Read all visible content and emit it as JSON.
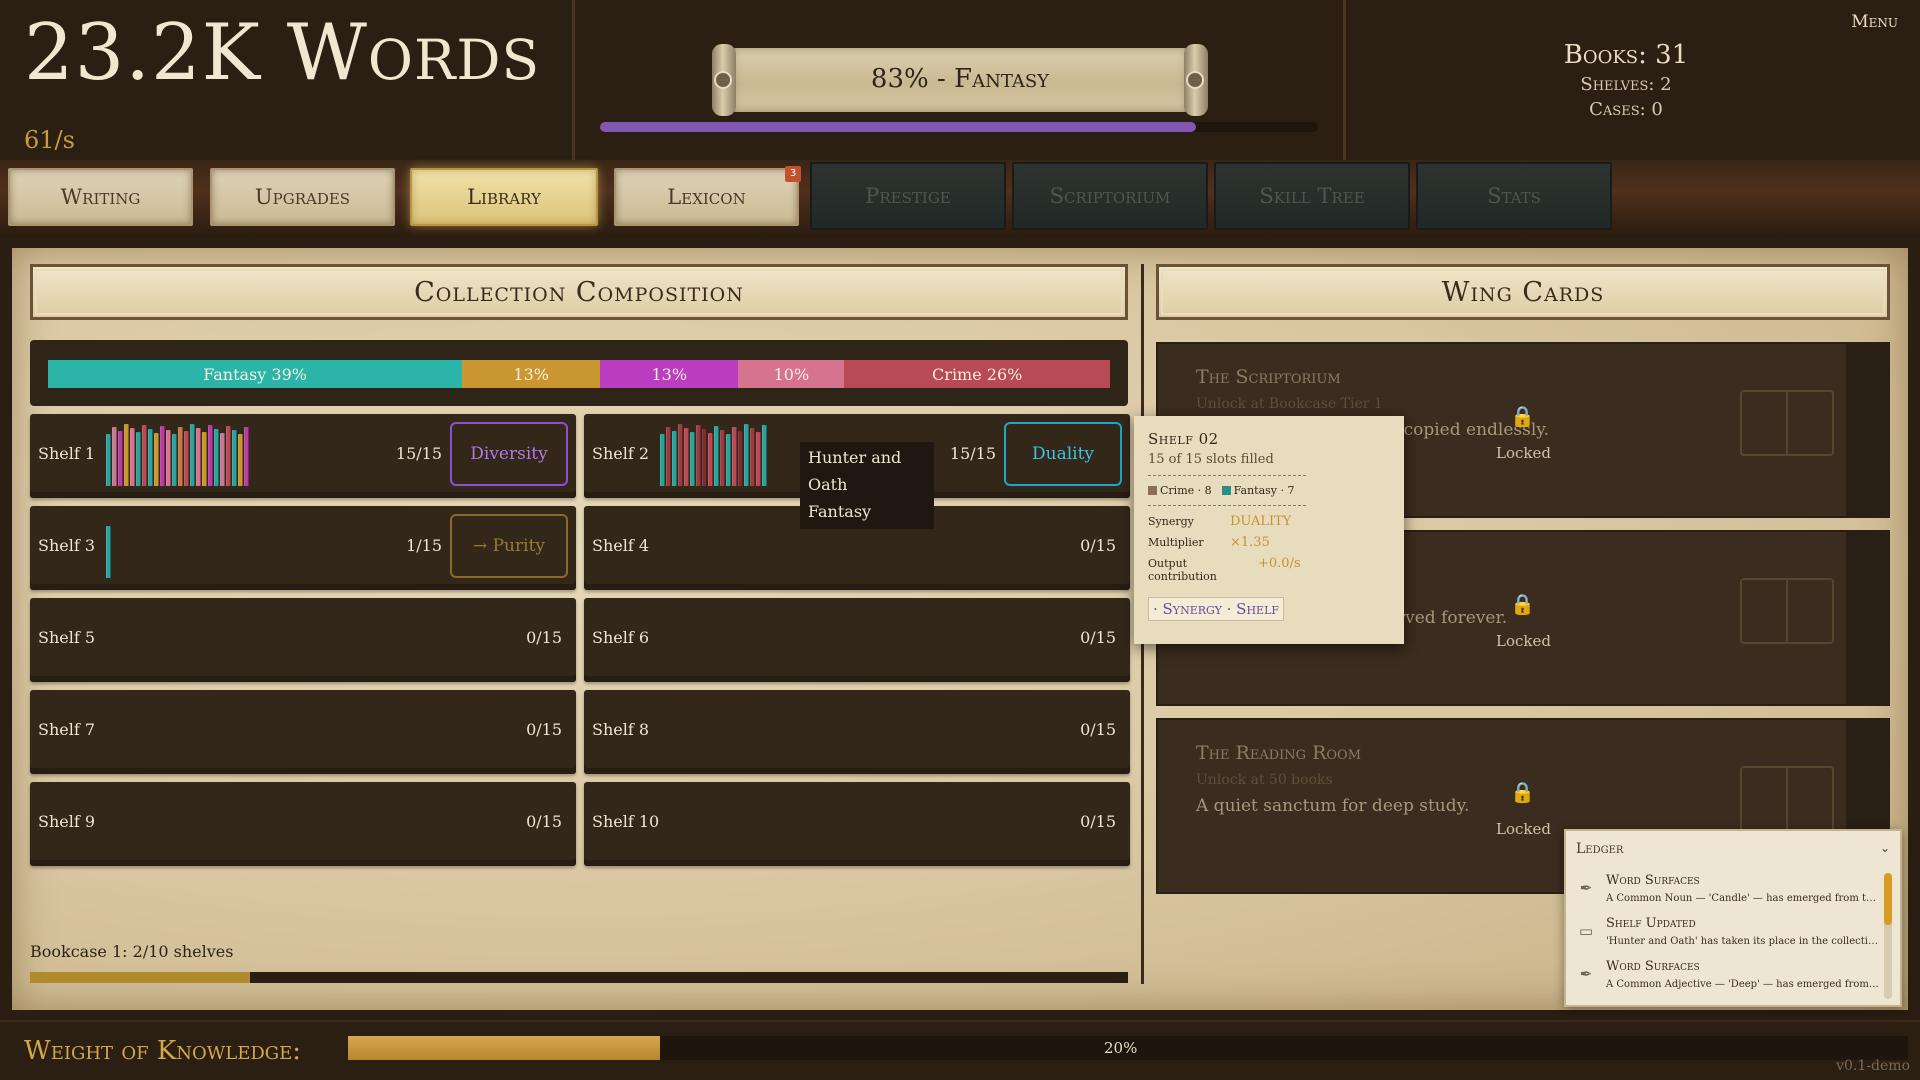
{
  "header": {
    "words": "23.2K Words",
    "rate": "61/s",
    "genre_label": "83% - Fantasy",
    "genre_progress": 0.83,
    "menu": "Menu",
    "books": "Books: 31",
    "shelves": "Shelves: 2",
    "cases": "Cases: 0"
  },
  "tabs": [
    {
      "label": "Writing",
      "state": "normal"
    },
    {
      "label": "Upgrades",
      "state": "normal"
    },
    {
      "label": "Library",
      "state": "active"
    },
    {
      "label": "Lexicon",
      "state": "normal",
      "badge": "3"
    },
    {
      "label": "Prestige",
      "state": "locked"
    },
    {
      "label": "Scriptorium",
      "state": "locked"
    },
    {
      "label": "Skill Tree",
      "state": "locked"
    },
    {
      "label": "Stats",
      "state": "locked"
    }
  ],
  "collection": {
    "title": "Collection Composition",
    "segments": [
      {
        "label": "Fantasy 39%",
        "pct": 39,
        "color": "#2bb5a8"
      },
      {
        "label": "13%",
        "pct": 13,
        "color": "#c9962f"
      },
      {
        "label": "13%",
        "pct": 13,
        "color": "#bb3ec1"
      },
      {
        "label": "10%",
        "pct": 10,
        "color": "#d6738f"
      },
      {
        "label": "Crime 26%",
        "pct": 25,
        "color": "#b84a55"
      }
    ]
  },
  "shelves": [
    {
      "name": "Shelf 1",
      "count": "15/15",
      "synergy": "Diversity",
      "syn_color": "#8a4fd6",
      "syn_text": "#b07ae6",
      "books": [
        "#2aa39a",
        "#c77a8f",
        "#b83ba6",
        "#c9962f",
        "#d6738f",
        "#2aa39a",
        "#b84a55",
        "#2aa39a",
        "#c9962f",
        "#b83ba6",
        "#d6738f",
        "#2aa39a",
        "#c77a3f",
        "#b84a55",
        "#2aa39a",
        "#d6738f",
        "#c9962f",
        "#b83ba6",
        "#2aa39a",
        "#c77a8f",
        "#b84a55",
        "#2aa39a",
        "#c9962f",
        "#b83ba6"
      ]
    },
    {
      "name": "Shelf 2",
      "count": "15/15",
      "synergy": "Duality",
      "syn_color": "#1fa5c8",
      "syn_text": "#3cc3e0",
      "books": [
        "#2aa39a",
        "#9b3b3f",
        "#2aa39a",
        "#9b3b3f",
        "#b84a55",
        "#2aa39a",
        "#9b3b3f",
        "#7b2c30",
        "#b84a55",
        "#2aa39a",
        "#9b3b3f",
        "#2aa39a",
        "#b84a55",
        "#7b2c30",
        "#2aa39a",
        "#9b3b3f",
        "#b84a55",
        "#2aa39a"
      ]
    },
    {
      "name": "Shelf 3",
      "count": "1/15",
      "synergy": "→ Purity",
      "syn_color": "#8a6a24",
      "syn_text": "#9a7a34",
      "books": [
        "#2aa39a"
      ]
    },
    {
      "name": "Shelf 4",
      "count": "0/15"
    },
    {
      "name": "Shelf 5",
      "count": "0/15"
    },
    {
      "name": "Shelf 6",
      "count": "0/15"
    },
    {
      "name": "Shelf 7",
      "count": "0/15"
    },
    {
      "name": "Shelf 8",
      "count": "0/15"
    },
    {
      "name": "Shelf 9",
      "count": "0/15"
    },
    {
      "name": "Shelf 10",
      "count": "0/15"
    }
  ],
  "book_tooltip": {
    "title": "Hunter and Oath",
    "genre": "Fantasy"
  },
  "bookcase": {
    "label": "Bookcase 1: 2/10 shelves",
    "progress": 0.2
  },
  "wing": {
    "title": "Wing Cards",
    "cards": [
      {
        "name": "The Scriptorium",
        "unlock": "Unlock at Bookcase Tier 1",
        "desc": "Where manuscripts are copied endlessly.",
        "status": "Locked"
      },
      {
        "name": "",
        "unlock": "",
        "desc": "Where works are preserved forever.",
        "status": "Locked"
      },
      {
        "name": "The Reading Room",
        "unlock": "Unlock at 50 books",
        "desc": "A quiet sanctum for deep study.",
        "status": "Locked"
      }
    ]
  },
  "shelf_tooltip": {
    "title": "Shelf 02",
    "subtitle": "15 of 15 slots filled",
    "legend": [
      {
        "label": "Crime · 8",
        "color": "#8a6d5a"
      },
      {
        "label": "Fantasy · 7",
        "color": "#2a8e88"
      }
    ],
    "synergy_key": "Synergy",
    "synergy_val": "DUALITY",
    "multiplier_key": "Multiplier",
    "multiplier_val": "×1.35",
    "output_key": "Output contribution",
    "output_val": "+0.0/s",
    "tag": "· Synergy · Shelf"
  },
  "ledger": {
    "title": "Ledger",
    "entries": [
      {
        "icon": "quill-icon",
        "glyph": "✒",
        "head": "Word Surfaces",
        "text": "A Common Noun — 'Candle' — has emerged from the text."
      },
      {
        "icon": "book-icon",
        "glyph": "▭",
        "head": "Shelf Updated",
        "text": "'Hunter and Oath' has taken its place in the collection."
      },
      {
        "icon": "quill-icon",
        "glyph": "✒",
        "head": "Word Surfaces",
        "text": "A Common Adjective — 'Deep' — has emerged from the text."
      }
    ]
  },
  "footer": {
    "label": "Weight of Knowledge:",
    "progress": 0.2,
    "pct_text": "20%",
    "version": "v0.1-demo"
  }
}
